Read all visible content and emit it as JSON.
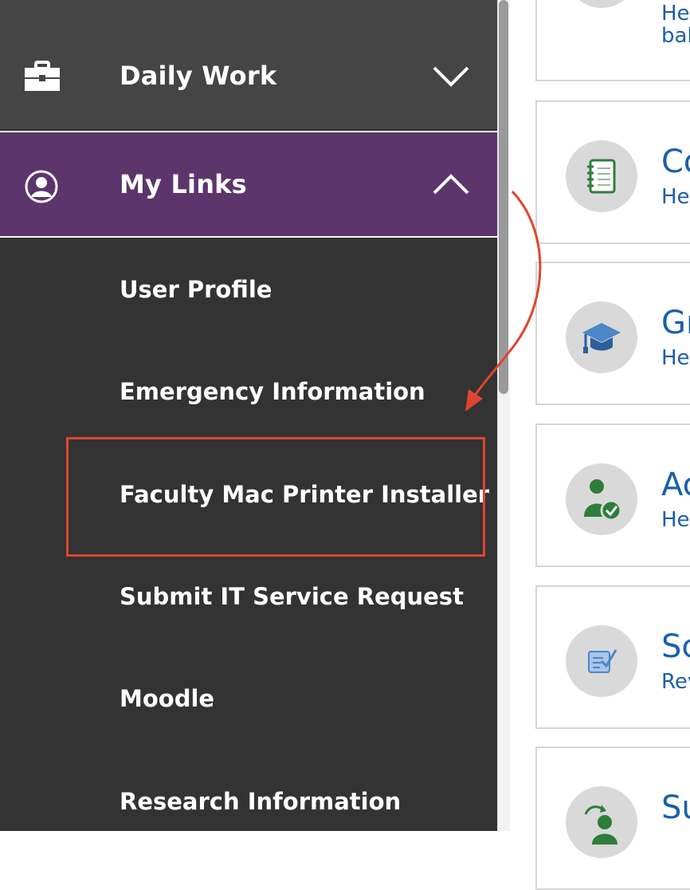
{
  "sidebar": {
    "sections": [
      {
        "label": "Daily Work",
        "icon": "briefcase-icon",
        "state": "collapsed"
      },
      {
        "label": "My Links",
        "icon": "user-circle-icon",
        "state": "expanded"
      }
    ],
    "links": [
      {
        "label": "User Profile"
      },
      {
        "label": "Emergency Information"
      },
      {
        "label": "Faculty Mac Printer Installer"
      },
      {
        "label": "Submit IT Service Request"
      },
      {
        "label": "Moodle"
      },
      {
        "label": "Research Information"
      }
    ]
  },
  "cards": [
    {
      "title": "",
      "sub": "He",
      "sub2": "bal",
      "icon": "green-icon"
    },
    {
      "title": "Co",
      "sub": "He",
      "icon": "notebook-icon"
    },
    {
      "title": "Gr",
      "sub": "He",
      "icon": "graduation-cap-icon"
    },
    {
      "title": "Ac",
      "sub": "He",
      "icon": "user-check-icon"
    },
    {
      "title": "Sc",
      "sub": "Rev",
      "icon": "checklist-icon"
    },
    {
      "title": "Su",
      "sub": "",
      "icon": "user-arrow-icon"
    }
  ],
  "colors": {
    "sidebar_bg": "#333333",
    "daily_work_bg": "#454545",
    "my_links_bg": "#5b356b",
    "highlight": "#e0442f",
    "link_blue": "#1b5fae"
  }
}
